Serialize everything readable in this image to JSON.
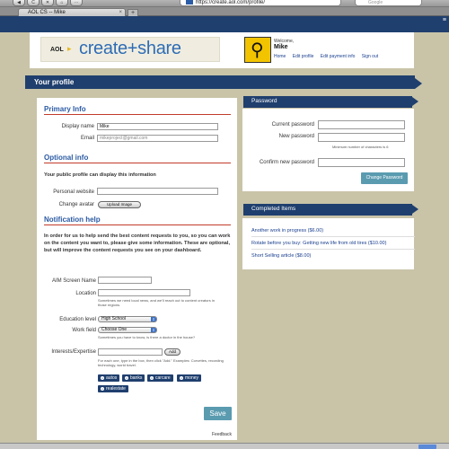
{
  "browser": {
    "url": "https://create.aol.com/profile/",
    "url_host_highlight": "aol.com",
    "search_placeholder": "Google",
    "tab_title": "AOL CS -- Mike"
  },
  "header": {
    "logo_aol": "AOL",
    "logo_title": "create+share",
    "welcome": "Welcome,",
    "username": "Mike",
    "links": [
      "Home",
      "Edit profile",
      "Edit payment info",
      "Sign out"
    ]
  },
  "page": {
    "ribbon_title": "Your profile",
    "feedback": "Feedback"
  },
  "primary": {
    "title": "Primary Info",
    "display_name_label": "Display name",
    "display_name_value": "Mike",
    "email_label": "Email",
    "email_value": "mikeproject@gmail.com"
  },
  "optional": {
    "title": "Optional info",
    "subtitle": "Your public profile can display this information",
    "website_label": "Personal website",
    "website_value": "",
    "avatar_label": "Change avatar",
    "upload_button": "Upload Image"
  },
  "notification": {
    "title": "Notification help",
    "intro": "In order for us to help send the best content requests to you, so you can work on the content you want to, please give some information. These are optional, but will improve the content requests you see on your dashboard.",
    "aim_label": "AIM Screen Name",
    "aim_value": "",
    "location_label": "Location",
    "location_value": "",
    "location_note": "Sometimes we need local news, and we'll reach out to content creators in those regions.",
    "education_label": "Education level",
    "education_value": "High School",
    "workfield_label": "Work field",
    "workfield_value": "Choose One",
    "workfield_note": "Sometimes you have to know, is there a doctor in the house?",
    "interests_label": "Interests/Expertise",
    "interests_value": "",
    "add_button": "Add",
    "interests_note": "For each one, type in the box, then click \"Add.\" Examples: Corvettes, recording technology, world travel.",
    "tags": [
      "autos",
      "banks",
      "carcare",
      "money",
      "realestate"
    ],
    "save_button": "Save"
  },
  "password": {
    "title": "Password",
    "current_label": "Current password",
    "new_label": "New password",
    "min_note": "Minimum number of characters is 6",
    "confirm_label": "Confirm new password",
    "change_button": "Change Password"
  },
  "completed": {
    "title": "Completed Items",
    "items": [
      "Another work in progress ($6.00)",
      "Rotate before you buy: Getting new life from old tires ($10.00)",
      "Short Selling article ($8.00)"
    ]
  },
  "colors": {
    "navy": "#1f3f6e",
    "accent_blue": "#2b5aa3",
    "button_teal": "#5a9bb0",
    "section_rule": "#c23b2a",
    "page_bg": "#c9c4a8"
  }
}
